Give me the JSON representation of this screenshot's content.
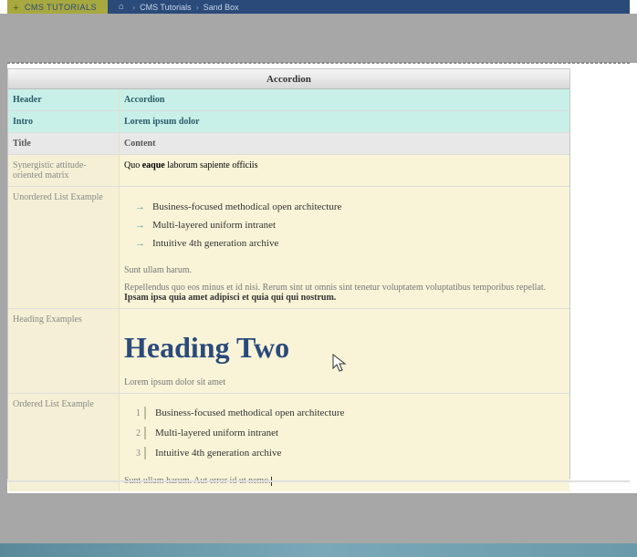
{
  "topbar": {
    "tab": {
      "plus": "+",
      "label": "CMS TUTORIALS"
    },
    "crumbs": {
      "home_icon": "⌂",
      "item1": "CMS Tutorials",
      "sep": "›",
      "item2": "Sand Box"
    }
  },
  "panel": {
    "title": "Accordion",
    "head_row": {
      "l": "Header",
      "r": "Accordion"
    },
    "intro_row": {
      "l": "Intro",
      "r": "Lorem ipsum dolor"
    },
    "sub_row": {
      "l": "Title",
      "r": "Content"
    },
    "row1": {
      "l": "Synergistic attitude-oriented matrix",
      "r_pre": "Quo ",
      "r_bold": "eaque",
      "r_post": " laborum sapiente officiis"
    },
    "row2": {
      "l": "Unordered List Example",
      "items": {
        "i0": "Business-focused methodical open architecture",
        "i1": "Multi-layered uniform intranet",
        "i2": "Intuitive 4th generation archive"
      },
      "p1": "Sunt ullam harum.",
      "p2_pre": "Repellendus quo eos minus et id nisi. Rerum sint ut omnis sint tenetur voluptatem voluptatibus temporibus repellat. ",
      "p2_bold": "Ipsam ipsa quia amet adipisci et quia qui qui nostrum."
    },
    "row3": {
      "l": "Heading Examples",
      "h2": "Heading Two",
      "p": "Lorem ipsum dolor sit amet"
    },
    "row4": {
      "l": "Ordered List Example",
      "items": {
        "n0": "1",
        "i0": "Business-focused methodical open architecture",
        "n1": "2",
        "i1": "Multi-layered uniform intranet",
        "n2": "3",
        "i2": "Intuitive 4th generation archive"
      },
      "p": "Sunt ullam harum. Aut error id ut nemo."
    }
  }
}
